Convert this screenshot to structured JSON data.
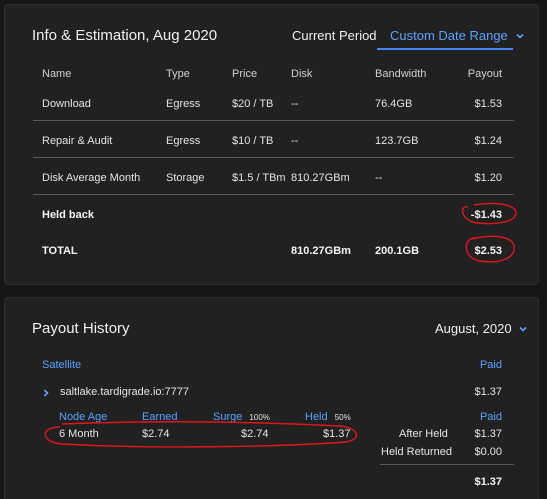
{
  "info": {
    "title": "Info & Estimation, Aug 2020",
    "current_period": "Current Period",
    "custom_date_range": "Custom Date Range",
    "columns": {
      "name": "Name",
      "type": "Type",
      "price": "Price",
      "disk": "Disk",
      "bandwidth": "Bandwidth",
      "payout": "Payout"
    },
    "rows": [
      {
        "name": "Download",
        "type": "Egress",
        "price": "$20 / TB",
        "disk": "--",
        "bandwidth": "76.4GB",
        "payout": "$1.53"
      },
      {
        "name": "Repair & Audit",
        "type": "Egress",
        "price": "$10 / TB",
        "disk": "--",
        "bandwidth": "123.7GB",
        "payout": "$1.24"
      },
      {
        "name": "Disk Average Month",
        "type": "Storage",
        "price": "$1.5 / TBm",
        "disk": "810.27GBm",
        "bandwidth": "--",
        "payout": "$1.20"
      }
    ],
    "held_back": {
      "label": "Held back",
      "payout": "-$1.43"
    },
    "total": {
      "label": "TOTAL",
      "disk": "810.27GBm",
      "bandwidth": "200.1GB",
      "payout": "$2.53"
    }
  },
  "payout_history": {
    "title": "Payout History",
    "month_selector": "August, 2020",
    "satellite_header": "Satellite",
    "paid_header": "Paid",
    "satellite": {
      "name": "saltlake.tardigrade.io:7777",
      "paid": "$1.37"
    },
    "detail_headers": {
      "node_age": "Node Age",
      "earned": "Earned",
      "surge": "Surge",
      "surge_pct": "100%",
      "held": "Held",
      "held_pct": "50%",
      "paid": "Paid"
    },
    "detail_row": {
      "node_age": "6 Month",
      "earned": "$2.74",
      "surge": "$2.74",
      "held": "$1.37"
    },
    "summary": [
      {
        "label": "After Held",
        "value": "$1.37"
      },
      {
        "label": "Held Returned",
        "value": "$0.00"
      }
    ],
    "total_paid": "$1.37"
  },
  "colors": {
    "accent": "#5aa1ff",
    "annotation": "#e0161c"
  }
}
